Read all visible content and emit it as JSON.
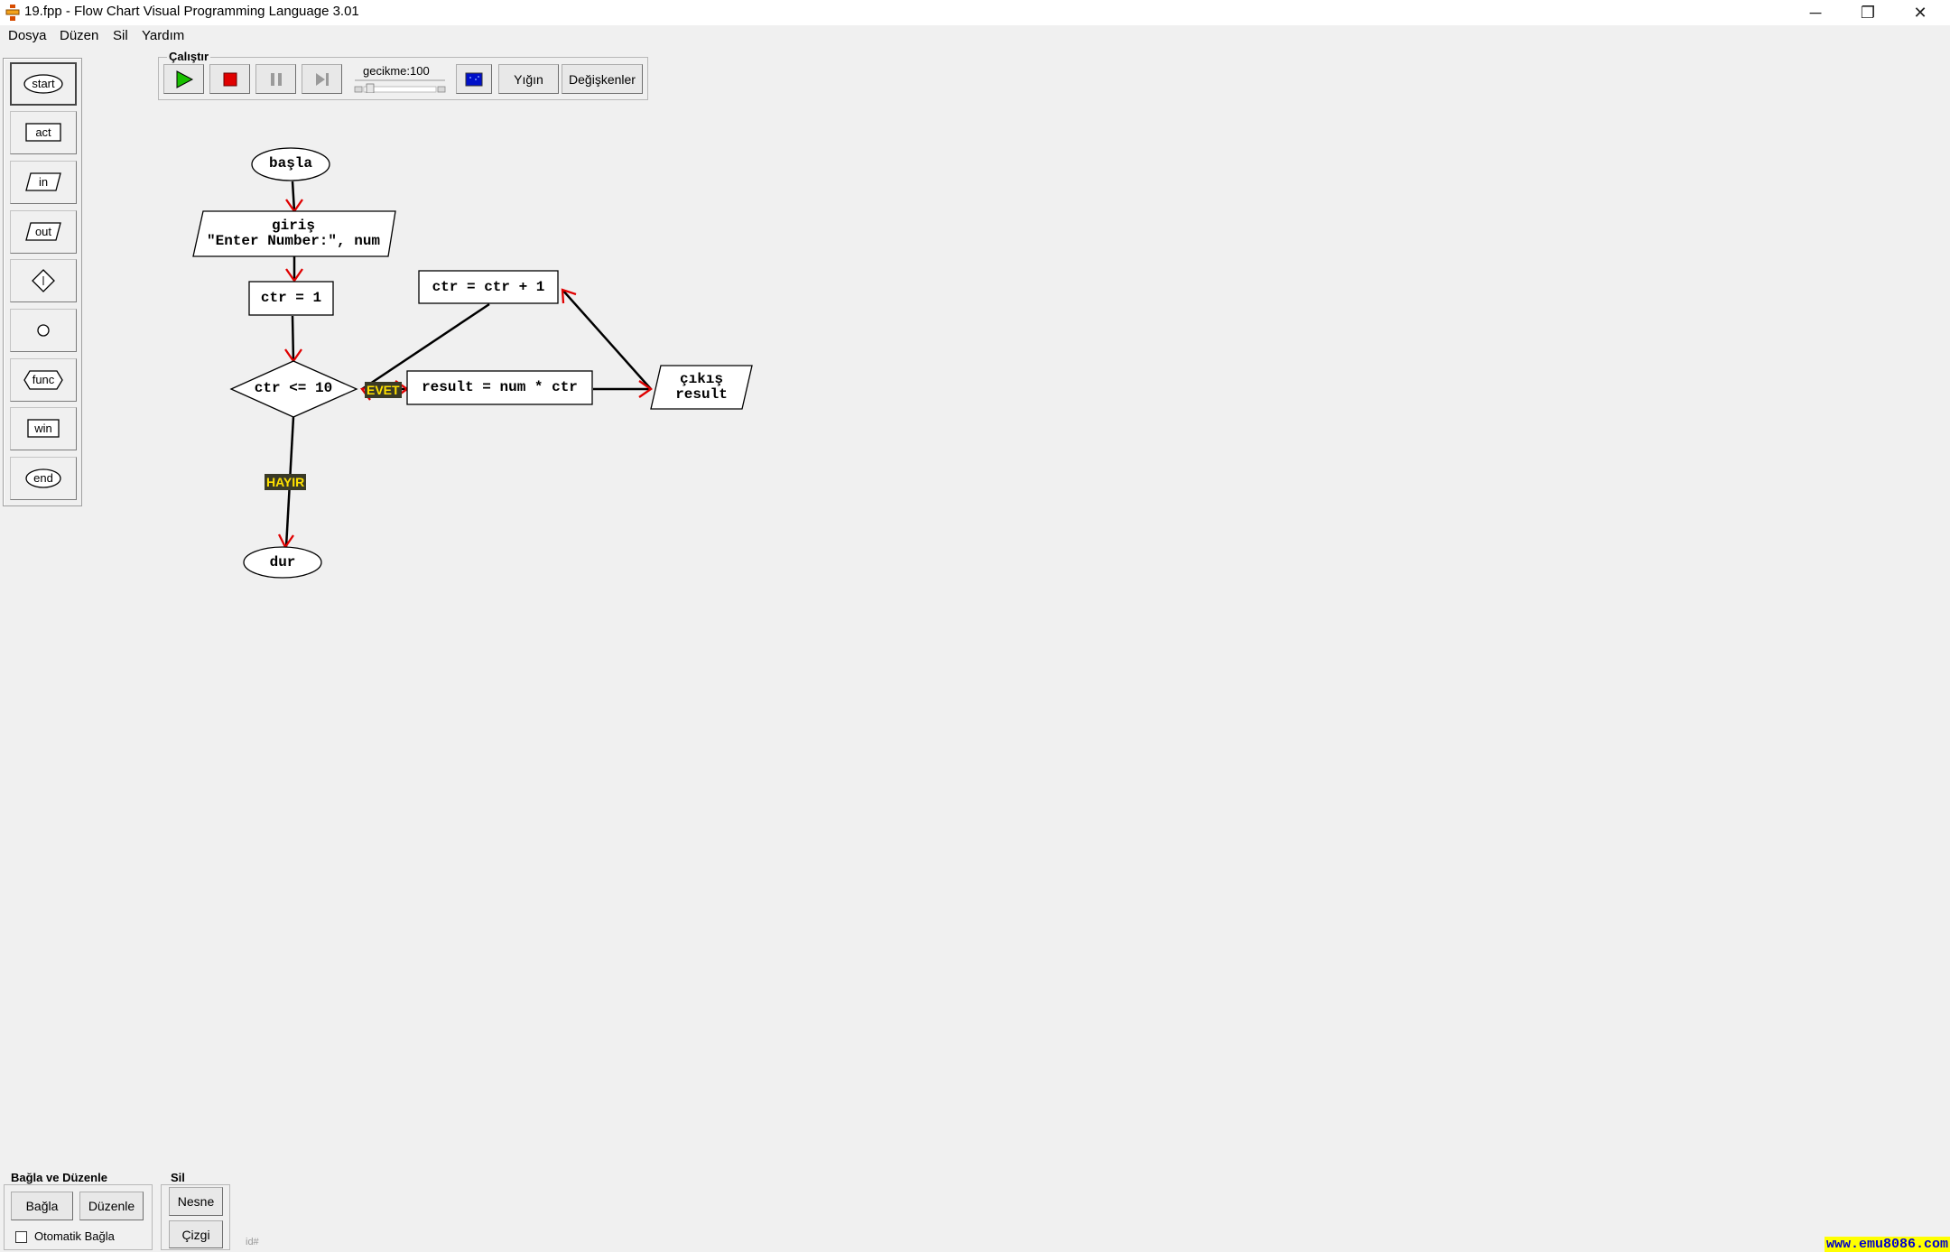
{
  "window": {
    "title": "19.fpp - Flow Chart Visual Programming Language 3.01",
    "minimize_symbol": "─",
    "maximize_symbol": "❐",
    "close_symbol": "✕"
  },
  "menu": [
    "Dosya",
    "Düzen",
    "Sil",
    "Yardım"
  ],
  "toolbox": {
    "items": [
      "start",
      "act",
      "in",
      "out",
      "",
      "",
      "func",
      "win",
      "end"
    ],
    "icons": [
      "start-oval-icon",
      "act-rectangle-icon",
      "in-parallelogram-icon",
      "out-parallelogram-icon",
      "decision-diamond-icon",
      "connector-circle-icon",
      "func-hexagon-icon",
      "win-rectangle-icon",
      "end-oval-icon"
    ]
  },
  "run_panel": {
    "label": "Çalıştır",
    "delay_label": "gecikme:100",
    "delay_value": 100,
    "stack_label": "Yığın",
    "variables_label": "Değişkenler",
    "icons": [
      "play-icon",
      "stop-icon",
      "pause-icon",
      "step-icon",
      "display-icon"
    ]
  },
  "flowchart": {
    "start": "başla",
    "input": [
      "giriş",
      "\"Enter Number:\", num"
    ],
    "init": "ctr = 1",
    "decision": "ctr <= 10",
    "yes_label": "EVET",
    "no_label": "HAYIR",
    "compute": "result = num * ctr",
    "output": [
      "çıkış",
      "result"
    ],
    "increment": "ctr = ctr + 1",
    "end": "dur"
  },
  "colors": {
    "arrowhead": "#e00000",
    "tag_bg": "#3a3a26",
    "tag_text": "#ffe100",
    "link_bg": "#ffff00",
    "link_text": "#0000cc"
  },
  "bottom": {
    "connect_group": "Bağla ve Düzenle",
    "connect_button": "Bağla",
    "arrange_button": "Düzenle",
    "auto_connect": "Otomatik Bağla",
    "auto_connect_checked": false,
    "delete_group": "Sil",
    "object_button": "Nesne",
    "line_button": "Çizgi",
    "id_text": "id#"
  },
  "status": {
    "link": "www.emu8086.com"
  }
}
